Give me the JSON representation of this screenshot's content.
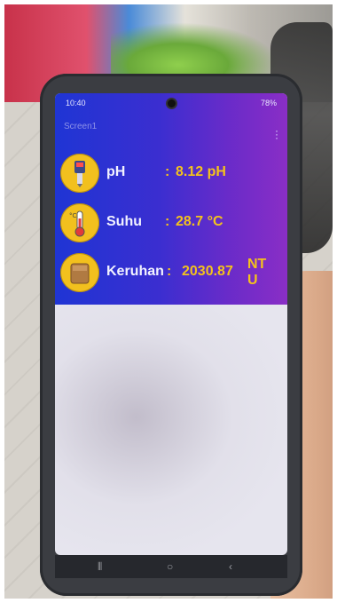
{
  "status": {
    "time": "10:40",
    "battery": "78%"
  },
  "app": {
    "title": "Screen1"
  },
  "readings": [
    {
      "label": "pH",
      "separator": ":",
      "value": "8.12 pH",
      "icon": "ph-meter-icon"
    },
    {
      "label": "Suhu",
      "separator": ":",
      "value": "28.7 °C",
      "icon": "thermometer-icon"
    },
    {
      "label": "Keruhan",
      "separator": ":",
      "value": "2030.87",
      "unit_line1": "NT",
      "unit_line2": "U",
      "icon": "turbidity-icon"
    }
  ],
  "nav": {
    "recent": "⦀",
    "home": "○",
    "back": "‹"
  },
  "colors": {
    "appbar_start": "#1f35d4",
    "appbar_end": "#8a2ec6",
    "value_yellow": "#f4c21c",
    "icon_bg": "#f2c01e"
  }
}
